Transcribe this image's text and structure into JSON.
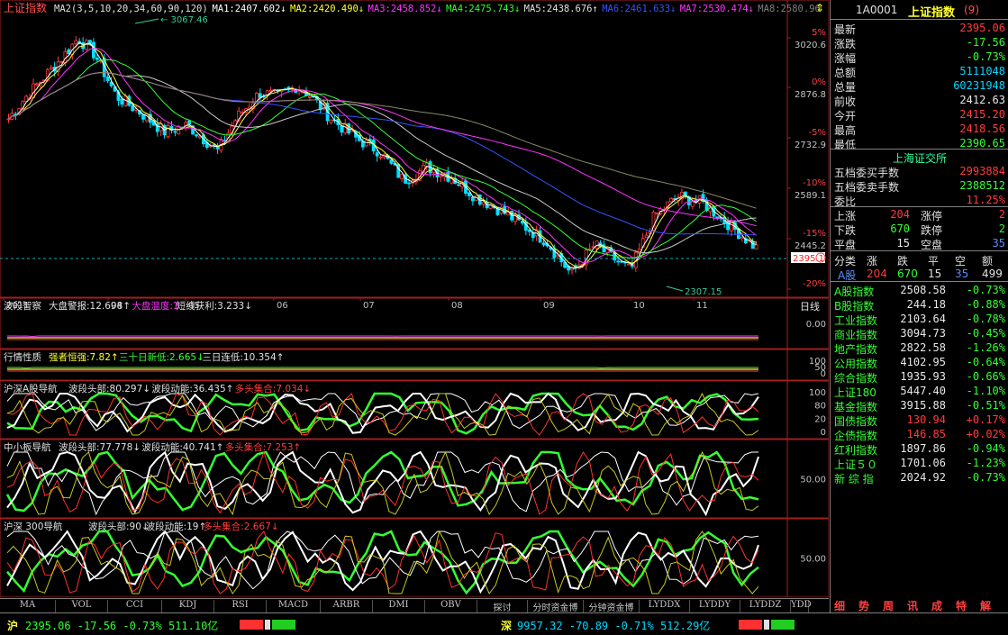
{
  "header": {
    "title": "上证指数",
    "ma_items": [
      {
        "label": "MA2(3,5,10,20,34,60,90,120)",
        "color": "#e0e0e0"
      },
      {
        "label": "MA1:2407.602↓",
        "color": "#ffffff"
      },
      {
        "label": "MA2:2420.490↓",
        "color": "#ffff33"
      },
      {
        "label": "MA3:2458.852↓",
        "color": "#ff33ff"
      },
      {
        "label": "MA4:2475.743↓",
        "color": "#33ff33"
      },
      {
        "label": "MA5:2438.676↑",
        "color": "#e0e0e0"
      },
      {
        "label": "MA6:2461.633↓",
        "color": "#3355ff"
      },
      {
        "label": "MA7:2530.474↓",
        "color": "#ff33ff"
      },
      {
        "label": "MA8:2580.96",
        "color": "#808080"
      }
    ]
  },
  "main_chart": {
    "high_label": "3067.46",
    "low_label": "2307.15",
    "last_price_tag": "2395.1",
    "y_ticks": [
      {
        "pct": "5%",
        "price": "3020.6"
      },
      {
        "pct": "0%",
        "price": "2876.8"
      },
      {
        "pct": "-5%",
        "price": "2732.9"
      },
      {
        "pct": "-10%",
        "price": "2589.1"
      },
      {
        "pct": "-15%",
        "price": "2445.2"
      },
      {
        "pct": "-20%",
        "price": ""
      }
    ],
    "x_labels": [
      "2011",
      "04",
      "05",
      "06",
      "07",
      "08",
      "09",
      "10",
      "11"
    ],
    "period": "日线"
  },
  "indicators": [
    {
      "name": "波段智察",
      "items": [
        {
          "text": "大盘警报:12.698↑",
          "color": "#e0e0e0"
        },
        {
          "text": "大盘温度:1",
          "color": "#ff33ff"
        },
        {
          "text": "短线获利:3.233↓",
          "color": "#e0e0e0"
        }
      ],
      "ticks": [
        "0.00"
      ]
    },
    {
      "name": "行情性质",
      "items": [
        {
          "text": "强者恒强:7.82↑",
          "color": "#ffff33"
        },
        {
          "text": "三十日新低:2.665↓",
          "color": "#33ff33"
        },
        {
          "text": "三日连低:10.354↑",
          "color": "#e0e0e0"
        }
      ],
      "ticks": [
        "100",
        "50",
        "0"
      ]
    },
    {
      "name": "沪深A股导航",
      "items": [
        {
          "text": "波段头部:80.297↓",
          "color": "#e0e0e0"
        },
        {
          "text": "波段动能:36.435↑",
          "color": "#e0e0e0"
        },
        {
          "text": "多头集合:7.034↓",
          "color": "#ff3c3c"
        }
      ],
      "ticks": [
        "100",
        "80",
        "20",
        "0"
      ]
    },
    {
      "name": "中小板导航",
      "items": [
        {
          "text": "波段头部:77.778↓",
          "color": "#e0e0e0"
        },
        {
          "text": "波段动能:40.741↑",
          "color": "#e0e0e0"
        },
        {
          "text": "多头集合:7.253↑",
          "color": "#ff3c3c"
        }
      ],
      "ticks": [
        "50.00"
      ]
    },
    {
      "name": "沪深 300导航",
      "items": [
        {
          "text": "波段头部:90↓",
          "color": "#e0e0e0"
        },
        {
          "text": "波段动能:19↑",
          "color": "#e0e0e0"
        },
        {
          "text": "多头集合:2.667↓",
          "color": "#ff3c3c"
        }
      ],
      "ticks": [
        "50.00"
      ]
    }
  ],
  "tabs": [
    "MA",
    "VOL",
    "CCI",
    "KDJ",
    "RSI",
    "MACD",
    "ARBR",
    "DMI",
    "OBV",
    "探讨",
    "分时资金博",
    "分钟资金博",
    "LYDDX",
    "LYDDY",
    "LYDDZ",
    "YDD"
  ],
  "sidebar": {
    "code": "1A0001",
    "name": "上证指数",
    "count": "(9)",
    "quotes": [
      {
        "k": "最新",
        "v": "2395.06",
        "c": "red"
      },
      {
        "k": "涨跌",
        "v": "-17.56",
        "c": "green"
      },
      {
        "k": "涨幅",
        "v": "-0.73%",
        "c": "green"
      },
      {
        "k": "总额",
        "v": "5111048",
        "c": "cyan"
      },
      {
        "k": "总量",
        "v": "60231948",
        "c": "cyan"
      },
      {
        "k": "前收",
        "v": "2412.63",
        "c": "white"
      },
      {
        "k": "今开",
        "v": "2415.20",
        "c": "red"
      },
      {
        "k": "最高",
        "v": "2418.56",
        "c": "red"
      },
      {
        "k": "最低",
        "v": "2390.65",
        "c": "green"
      }
    ],
    "exchange": "上海证交所",
    "orders": [
      {
        "k": "五档委买手数",
        "v": "2993884",
        "c": "red"
      },
      {
        "k": "五档委卖手数",
        "v": "2388512",
        "c": "green"
      },
      {
        "k": "委比",
        "v": "11.25%",
        "c": "red"
      }
    ],
    "breadth": [
      {
        "k1": "上涨",
        "v1": "204",
        "k2": "涨停",
        "v2": "2"
      },
      {
        "k1": "下跌",
        "v1": "670",
        "k2": "跌停",
        "v2": "2"
      },
      {
        "k1": "平盘",
        "v1": "15",
        "k2": "空盘",
        "v2": "35"
      }
    ],
    "table_head": [
      "分类",
      "涨",
      "跌",
      "平",
      "空",
      "额"
    ],
    "table_row": [
      "A股",
      "204",
      "670",
      "15",
      "35",
      "499"
    ],
    "indices": [
      {
        "k": "A股指数",
        "v": "2508.58",
        "p": "-0.73%",
        "c": "green"
      },
      {
        "k": "B股指数",
        "v": "244.18",
        "p": "-0.88%",
        "c": "green"
      },
      {
        "k": "工业指数",
        "v": "2103.64",
        "p": "-0.78%",
        "c": "green"
      },
      {
        "k": "商业指数",
        "v": "3094.73",
        "p": "-0.45%",
        "c": "green"
      },
      {
        "k": "地产指数",
        "v": "2822.58",
        "p": "-1.26%",
        "c": "green"
      },
      {
        "k": "公用指数",
        "v": "4102.95",
        "p": "-0.64%",
        "c": "green"
      },
      {
        "k": "综合指数",
        "v": "1935.93",
        "p": "-0.66%",
        "c": "green"
      },
      {
        "k": "上证180",
        "v": "5447.40",
        "p": "-1.10%",
        "c": "green"
      },
      {
        "k": "基金指数",
        "v": "3915.88",
        "p": "-0.51%",
        "c": "green"
      },
      {
        "k": "国债指数",
        "v": "130.94",
        "p": "+0.17%",
        "c": "red"
      },
      {
        "k": "企债指数",
        "v": "146.85",
        "p": "+0.02%",
        "c": "red"
      },
      {
        "k": "红利指数",
        "v": "1897.86",
        "p": "-0.94%",
        "c": "green"
      },
      {
        "k": "上证５０",
        "v": "1701.06",
        "p": "-1.23%",
        "c": "green"
      },
      {
        "k": "新 综 指",
        "v": "2024.92",
        "p": "-0.73%",
        "c": "green"
      }
    ],
    "bottom_tabs": [
      "细",
      "势",
      "周",
      "讯",
      "成",
      "特",
      "解"
    ]
  },
  "bottombar": {
    "sh_label": "沪",
    "sh_text": "2395.06 -17.56 -0.73% 511.10亿",
    "sz_label": "深",
    "sz_text": "9957.32 -70.89 -0.71% 512.29亿"
  }
}
